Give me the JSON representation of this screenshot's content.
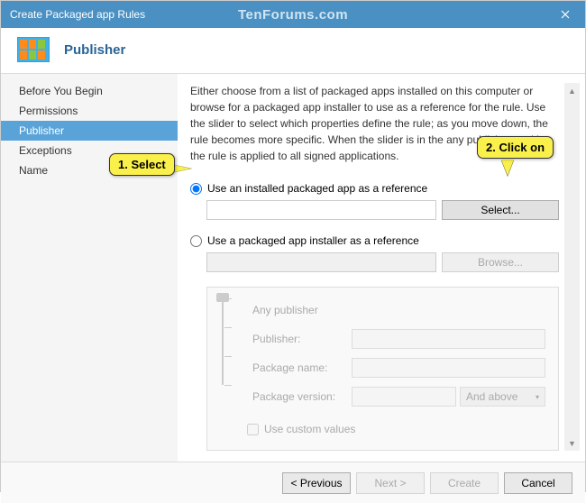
{
  "titlebar": {
    "title": "Create Packaged app Rules",
    "watermark": "TenForums.com"
  },
  "header": {
    "title": "Publisher"
  },
  "sidebar": {
    "items": [
      {
        "label": "Before You Begin"
      },
      {
        "label": "Permissions"
      },
      {
        "label": "Publisher"
      },
      {
        "label": "Exceptions"
      },
      {
        "label": "Name"
      }
    ]
  },
  "content": {
    "instructions": "Either choose from a list of packaged apps installed on this computer or browse for a packaged app installer to use as a reference for the rule. Use the slider to select which properties define the rule; as you move down, the rule becomes more specific. When the slider is in the any publisher position, the rule is applied to all signed applications.",
    "radio1": "Use an installed packaged app as a reference",
    "radio2": "Use a packaged app installer as a reference",
    "select_btn": "Select...",
    "browse_btn": "Browse...",
    "slider": {
      "any": "Any publisher",
      "labels": [
        "Publisher:",
        "Package name:",
        "Package version:"
      ],
      "and_above": "And above"
    },
    "custom_values": "Use custom values"
  },
  "footer": {
    "previous": "< Previous",
    "next": "Next >",
    "create": "Create",
    "cancel": "Cancel"
  },
  "callouts": {
    "c1": "1. Select",
    "c2": "2. Click on"
  }
}
